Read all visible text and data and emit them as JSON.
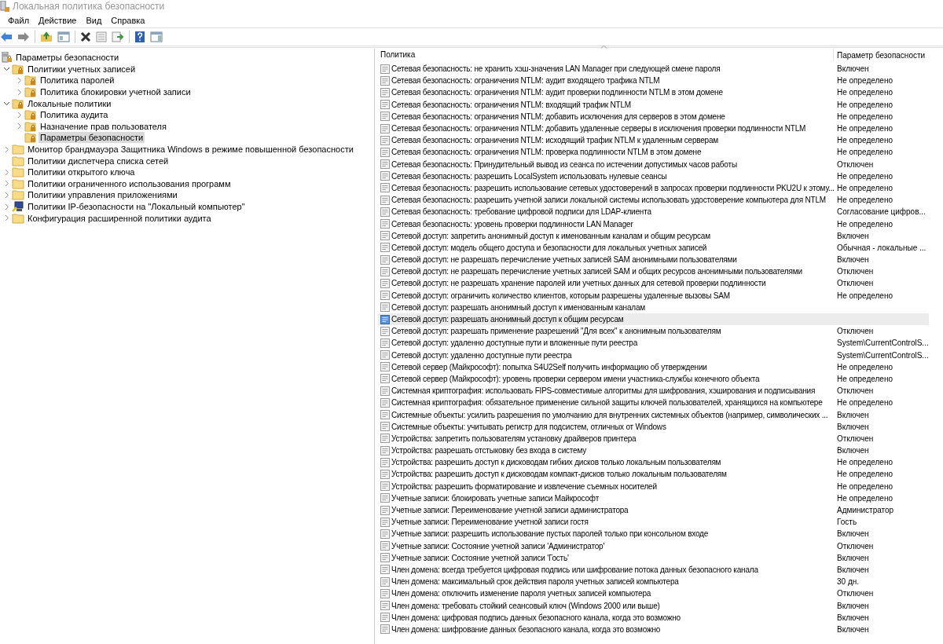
{
  "window": {
    "title": "Локальная политика безопасности"
  },
  "menu": [
    "Файл",
    "Действие",
    "Вид",
    "Справка"
  ],
  "tree": [
    {
      "label": "Параметры безопасности",
      "kind": "root",
      "selected": false,
      "children": [
        {
          "label": "Политики учетных записей",
          "kind": "locked-folder",
          "expanded": true,
          "selected": false,
          "children": [
            {
              "label": "Политика паролей",
              "kind": "locked-folder",
              "expanded": false,
              "selected": false,
              "expandable": true
            },
            {
              "label": "Политика блокировки учетной записи",
              "kind": "locked-folder",
              "expanded": false,
              "selected": false,
              "expandable": true
            }
          ]
        },
        {
          "label": "Локальные политики",
          "kind": "locked-folder",
          "expanded": true,
          "selected": false,
          "children": [
            {
              "label": "Политика аудита",
              "kind": "locked-folder",
              "expanded": false,
              "selected": false,
              "expandable": true
            },
            {
              "label": "Назначение прав пользователя",
              "kind": "locked-folder",
              "expanded": false,
              "selected": false,
              "expandable": true
            },
            {
              "label": "Параметры безопасности",
              "kind": "locked-folder",
              "expanded": false,
              "selected": true,
              "expandable": false
            }
          ]
        },
        {
          "label": "Монитор брандмауэра Защитника Windows в режиме повышенной безопасности",
          "kind": "folder",
          "expanded": false,
          "selected": false,
          "expandable": true
        },
        {
          "label": "Политики диспетчера списка сетей",
          "kind": "folder",
          "expanded": false,
          "selected": false,
          "expandable": false
        },
        {
          "label": "Политики открытого ключа",
          "kind": "folder",
          "expanded": false,
          "selected": false,
          "expandable": true
        },
        {
          "label": "Политики ограниченного использования программ",
          "kind": "folder",
          "expanded": false,
          "selected": false,
          "expandable": true
        },
        {
          "label": "Политики управления приложениями",
          "kind": "folder",
          "expanded": false,
          "selected": false,
          "expandable": true
        },
        {
          "label": "Политики IP-безопасности на \"Локальный компьютер\"",
          "kind": "network",
          "expanded": false,
          "selected": false,
          "expandable": true
        },
        {
          "label": "Конфигурация расширенной политики аудита",
          "kind": "folder",
          "expanded": false,
          "selected": false,
          "expandable": true
        }
      ]
    }
  ],
  "table": {
    "columns": [
      "Политика",
      "Параметр безопасности"
    ],
    "rows": [
      {
        "policy": "Сетевая безопасность: не хранить хэш-значения LAN Manager при следующей смене пароля",
        "setting": "Включен",
        "selected": false
      },
      {
        "policy": "Сетевая безопасность: ограничения NTLM: аудит входящего трафика NTLM",
        "setting": "Не определено",
        "selected": false
      },
      {
        "policy": "Сетевая безопасность: ограничения NTLM: аудит проверки подлинности NTLM в этом домене",
        "setting": "Не определено",
        "selected": false
      },
      {
        "policy": "Сетевая безопасность: ограничения NTLM: входящий трафик NTLM",
        "setting": "Не определено",
        "selected": false
      },
      {
        "policy": "Сетевая безопасность: ограничения NTLM: добавить исключения для серверов в этом домене",
        "setting": "Не определено",
        "selected": false
      },
      {
        "policy": "Сетевая безопасность: ограничения NTLM: добавить удаленные серверы в исключения проверки подлинности NTLM",
        "setting": "Не определено",
        "selected": false
      },
      {
        "policy": "Сетевая безопасность: ограничения NTLM: исходящий трафик NTLM к удаленным серверам",
        "setting": "Не определено",
        "selected": false
      },
      {
        "policy": "Сетевая безопасность: ограничения NTLM: проверка подлинности NTLM в этом домене",
        "setting": "Не определено",
        "selected": false
      },
      {
        "policy": "Сетевая безопасность: Принудительный вывод из сеанса по истечении допустимых часов работы",
        "setting": "Отключен",
        "selected": false
      },
      {
        "policy": "Сетевая безопасность: разрешить LocalSystem использовать нулевые сеансы",
        "setting": "Не определено",
        "selected": false
      },
      {
        "policy": "Сетевая безопасность: разрешить использование сетевых удостоверений в запросах проверки подлинности PKU2U к этому...",
        "setting": "Не определено",
        "selected": false
      },
      {
        "policy": "Сетевая безопасность: разрешить учетной записи локальной системы использовать удостоверение компьютера для NTLM",
        "setting": "Не определено",
        "selected": false
      },
      {
        "policy": "Сетевая безопасность: требование цифровой подписи для LDAP-клиента",
        "setting": "Согласование цифров...",
        "selected": false
      },
      {
        "policy": "Сетевая безопасность: уровень проверки подлинности LAN Manager",
        "setting": "Не определено",
        "selected": false
      },
      {
        "policy": "Сетевой доступ: запретить анонимный доступ к именованным каналам и общим ресурсам",
        "setting": "Включен",
        "selected": false
      },
      {
        "policy": "Сетевой доступ: модель общего доступа и безопасности для локальных учетных записей",
        "setting": "Обычная - локальные ...",
        "selected": false
      },
      {
        "policy": "Сетевой доступ: не разрешать перечисление учетных записей SAM анонимными пользователями",
        "setting": "Включен",
        "selected": false
      },
      {
        "policy": "Сетевой доступ: не разрешать перечисление учетных записей SAM и общих ресурсов анонимными пользователями",
        "setting": "Отключен",
        "selected": false
      },
      {
        "policy": "Сетевой доступ: не разрешать хранение паролей или учетных данных для сетевой проверки подлинности",
        "setting": "Отключен",
        "selected": false
      },
      {
        "policy": "Сетевой доступ: ограничить количество клиентов, которым разрешены удаленные вызовы SAM",
        "setting": "Не определено",
        "selected": false
      },
      {
        "policy": "Сетевой доступ: разрешать анонимный доступ к именованным каналам",
        "selected": false
      },
      {
        "policy": "Сетевой доступ: разрешать анонимный доступ к общим ресурсам",
        "selected": true
      },
      {
        "policy": "Сетевой доступ: разрешать применение разрешений \"Для всех\" к анонимным пользователям",
        "setting": "Отключен",
        "selected": false
      },
      {
        "policy": "Сетевой доступ: удаленно доступные пути и вложенные пути реестра",
        "setting": "System\\CurrentControlS...",
        "selected": false
      },
      {
        "policy": "Сетевой доступ: удаленно доступные пути реестра",
        "setting": "System\\CurrentControlS...",
        "selected": false
      },
      {
        "policy": "Сетевой сервер (Майкрософт): попытка S4U2Self получить информацию об утверждении",
        "setting": "Не определено",
        "selected": false
      },
      {
        "policy": "Сетевой сервер (Майкрософт): уровень проверки сервером имени участника-службы конечного объекта",
        "setting": "Не определено",
        "selected": false
      },
      {
        "policy": "Системная криптография: использовать FIPS-совместимые алгоритмы для шифрования, хэширования и подписывания",
        "setting": "Отключен",
        "selected": false
      },
      {
        "policy": "Системная криптография: обязательное применение сильной защиты ключей пользователей, хранящихся на компьютере",
        "setting": "Не определено",
        "selected": false
      },
      {
        "policy": "Системные объекты: усилить разрешения по умолчанию для внутренних системных объектов (например, символических ...",
        "setting": "Включен",
        "selected": false
      },
      {
        "policy": "Системные объекты: учитывать регистр для подсистем, отличных от Windows",
        "setting": "Включен",
        "selected": false
      },
      {
        "policy": "Устройства: запретить пользователям установку драйверов принтера",
        "setting": "Отключен",
        "selected": false
      },
      {
        "policy": "Устройства: разрешать отстыковку без входа в систему",
        "setting": "Включен",
        "selected": false
      },
      {
        "policy": "Устройства: разрешить доступ к дисководам гибких дисков только локальным пользователям",
        "setting": "Не определено",
        "selected": false
      },
      {
        "policy": "Устройства: разрешить доступ к дисководам компакт-дисков только локальным пользователям",
        "setting": "Не определено",
        "selected": false
      },
      {
        "policy": "Устройства: разрешить форматирование и извлечение съемных носителей",
        "setting": "Не определено",
        "selected": false
      },
      {
        "policy": "Учетные записи: блокировать учетные записи Майкрософт",
        "setting": "Не определено",
        "selected": false
      },
      {
        "policy": "Учетные записи: Переименование учетной записи администратора",
        "setting": "Администратор",
        "selected": false
      },
      {
        "policy": "Учетные записи: Переименование учетной записи гостя",
        "setting": "Гость",
        "selected": false
      },
      {
        "policy": "Учетные записи: разрешить использование пустых паролей только при консольном входе",
        "setting": "Включен",
        "selected": false
      },
      {
        "policy": "Учетные записи: Состояние учетной записи 'Администратор'",
        "setting": "Отключен",
        "selected": false
      },
      {
        "policy": "Учетные записи: Состояние учетной записи 'Гость'",
        "setting": "Включен",
        "selected": false
      },
      {
        "policy": "Член домена: всегда требуется цифровая подпись или шифрование потока данных безопасного канала",
        "setting": "Включен",
        "selected": false
      },
      {
        "policy": "Член домена: максимальный срок действия пароля учетных записей компьютера",
        "setting": "30 дн.",
        "selected": false
      },
      {
        "policy": "Член домена: отключить изменение пароля учетных записей компьютера",
        "setting": "Отключен",
        "selected": false
      },
      {
        "policy": "Член домена: требовать стойкий сеансовый ключ (Windows 2000 или выше)",
        "setting": "Включен",
        "selected": false
      },
      {
        "policy": "Член домена: цифровая подпись данных безопасного канала, когда это возможно",
        "setting": "Включен",
        "selected": false
      },
      {
        "policy": "Член домена: шифрование данных безопасного канала, когда это возможно",
        "setting": "Включен",
        "selected": false
      }
    ]
  }
}
